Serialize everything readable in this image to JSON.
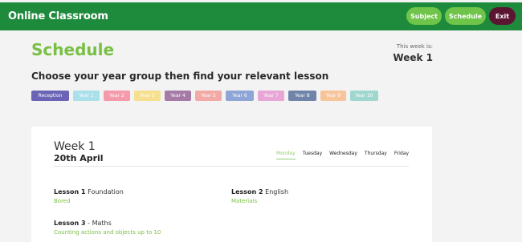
{
  "app": {
    "title": "Online Classroom"
  },
  "nav": {
    "subject": "Subject",
    "schedule": "Schedule",
    "exit": "Exit"
  },
  "colors": {
    "topbar": "#1e8a3c",
    "accent": "#78c043",
    "exit": "#5b1530"
  },
  "page": {
    "title": "Schedule",
    "this_week_label": "This week is:",
    "this_week_value": "Week 1",
    "instruction": "Choose your year group then find your relevant lesson"
  },
  "years": [
    {
      "label": "Reception",
      "color": "#6b63b5"
    },
    {
      "label": "Year 1",
      "color": "#a9e0ea"
    },
    {
      "label": "Year 2",
      "color": "#f49aab"
    },
    {
      "label": "Year 3",
      "color": "#f6df8e"
    },
    {
      "label": "Year 4",
      "color": "#a67aa7"
    },
    {
      "label": "Year 5",
      "color": "#f3a9a5"
    },
    {
      "label": "Year 6",
      "color": "#8ea5d6"
    },
    {
      "label": "Year 7",
      "color": "#e7a6d6"
    },
    {
      "label": "Year 8",
      "color": "#6f84a8"
    },
    {
      "label": "Year 9",
      "color": "#f8c49a"
    },
    {
      "label": "Year 10",
      "color": "#9fd7cf"
    }
  ],
  "card": {
    "week": "Week 1",
    "date": "20th April",
    "days": [
      "Monday",
      "Tuesday",
      "Wednesday",
      "Thursday",
      "Friday"
    ],
    "active_day": "Monday",
    "lessons": [
      {
        "number": "Lesson 1",
        "separator": "",
        "subject": "Foundation",
        "detail": "Bored"
      },
      {
        "number": "Lesson 2",
        "separator": "",
        "subject": "English",
        "detail": "Materials"
      },
      {
        "number": "Lesson 3",
        "separator": " - ",
        "subject": "Maths",
        "detail": "Counting actions and objects up to 10"
      }
    ]
  }
}
